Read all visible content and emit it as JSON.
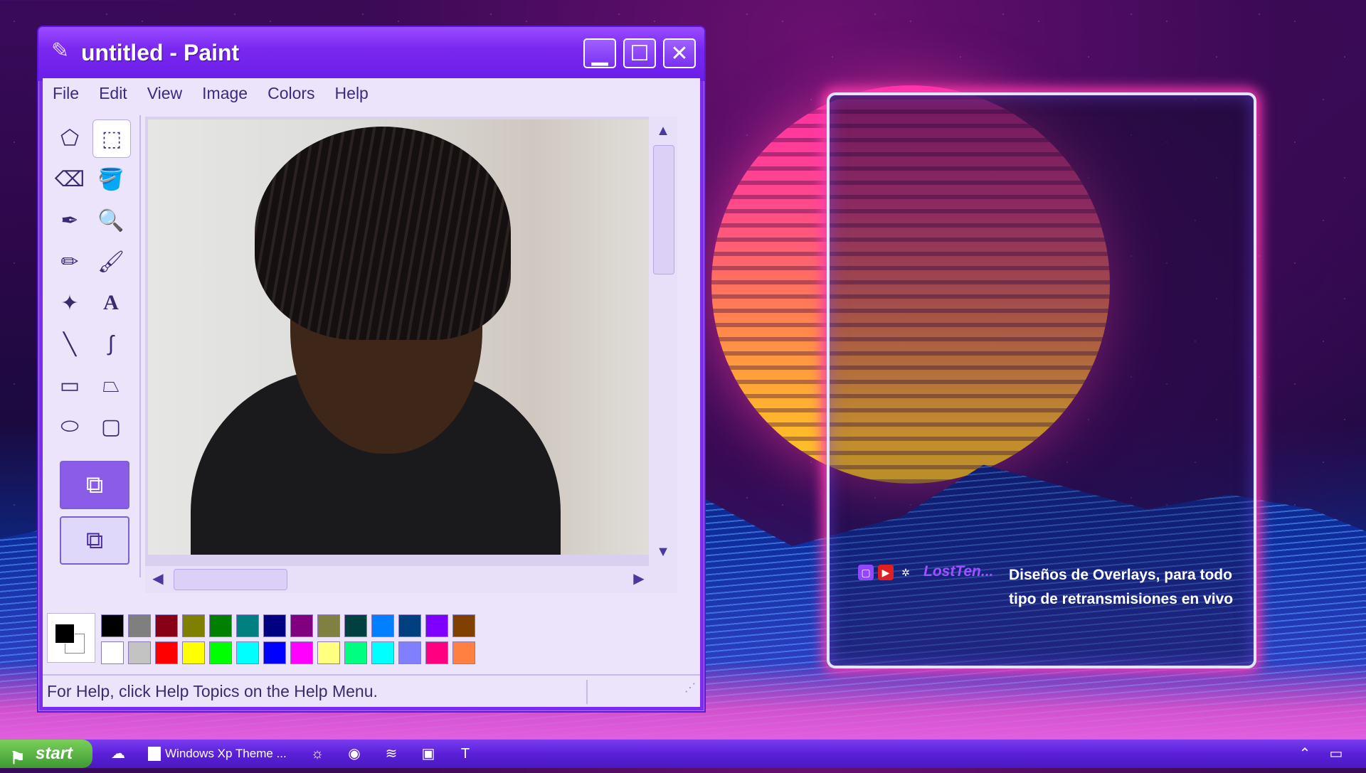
{
  "window": {
    "title": "untitled - Paint",
    "buttons": {
      "minimize": "▁",
      "maximize": "☐",
      "close": "✕"
    }
  },
  "menu": [
    "File",
    "Edit",
    "View",
    "Image",
    "Colors",
    "Help"
  ],
  "tools": [
    {
      "name": "free-select-icon",
      "glyph": "⬠"
    },
    {
      "name": "rect-select-icon",
      "glyph": "⬚"
    },
    {
      "name": "eraser-icon",
      "glyph": "⌫"
    },
    {
      "name": "fill-bucket-icon",
      "glyph": "🪣"
    },
    {
      "name": "color-picker-icon",
      "glyph": "✒"
    },
    {
      "name": "magnifier-icon",
      "glyph": "🔍"
    },
    {
      "name": "pencil-icon",
      "glyph": "✏"
    },
    {
      "name": "brush-icon",
      "glyph": "🖌"
    },
    {
      "name": "airbrush-icon",
      "glyph": "✦"
    },
    {
      "name": "text-icon",
      "glyph": "A"
    },
    {
      "name": "line-icon",
      "glyph": "╲"
    },
    {
      "name": "curve-icon",
      "glyph": "∫"
    },
    {
      "name": "rectangle-icon",
      "glyph": "▭"
    },
    {
      "name": "polygon-icon",
      "glyph": "⏢"
    },
    {
      "name": "ellipse-icon",
      "glyph": "⬭"
    },
    {
      "name": "rounded-rect-icon",
      "glyph": "▢"
    }
  ],
  "palette": {
    "row1": [
      "#000000",
      "#7f7f7f",
      "#880015",
      "#808000",
      "#008000",
      "#008080",
      "#000080",
      "#800080",
      "#808040",
      "#004040",
      "#0080ff",
      "#004080",
      "#8000ff",
      "#804000"
    ],
    "row2": [
      "#ffffff",
      "#c3c3c3",
      "#ff0000",
      "#ffff00",
      "#00ff00",
      "#00ffff",
      "#0000ff",
      "#ff00ff",
      "#ffff80",
      "#00ff80",
      "#00ffff",
      "#8080ff",
      "#ff0080",
      "#ff8040"
    ]
  },
  "status": "For Help, click Help Topics on the Help Menu.",
  "chat": {
    "user": "LostTen...",
    "message": "Diseños de Overlays, para todo tipo de retransmisiones en vivo"
  },
  "taskbar": {
    "start": "start",
    "task": "Windows Xp Theme ..."
  }
}
